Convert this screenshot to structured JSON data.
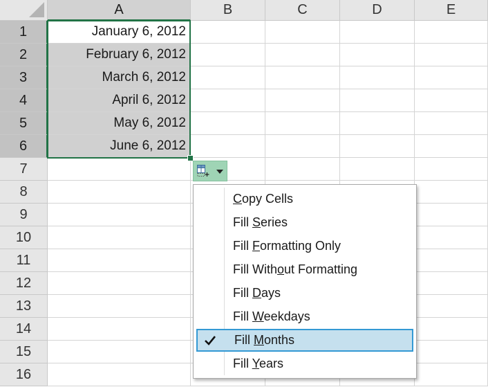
{
  "columns": [
    "A",
    "B",
    "C",
    "D",
    "E"
  ],
  "rows": [
    "1",
    "2",
    "3",
    "4",
    "5",
    "6",
    "7",
    "8",
    "9",
    "10",
    "11",
    "12",
    "13",
    "14",
    "15",
    "16"
  ],
  "cells_A": [
    "January 6, 2012",
    "February 6, 2012",
    "March 6, 2012",
    "April 6, 2012",
    "May 6, 2012",
    "June 6, 2012"
  ],
  "autofill_menu": {
    "items": [
      {
        "pre": "",
        "u": "C",
        "post": "opy Cells",
        "checked": false
      },
      {
        "pre": "Fill ",
        "u": "S",
        "post": "eries",
        "checked": false
      },
      {
        "pre": "Fill ",
        "u": "F",
        "post": "ormatting Only",
        "checked": false
      },
      {
        "pre": "Fill With",
        "u": "o",
        "post": "ut Formatting",
        "checked": false
      },
      {
        "pre": "Fill ",
        "u": "D",
        "post": "ays",
        "checked": false
      },
      {
        "pre": "Fill ",
        "u": "W",
        "post": "eekdays",
        "checked": false
      },
      {
        "pre": "Fill ",
        "u": "M",
        "post": "onths",
        "checked": true
      },
      {
        "pre": "Fill ",
        "u": "Y",
        "post": "ears",
        "checked": false
      }
    ]
  },
  "colors": {
    "selection_accent": "#217346",
    "menu_highlight": "#c5e0ee",
    "menu_highlight_border": "#3399d4"
  }
}
